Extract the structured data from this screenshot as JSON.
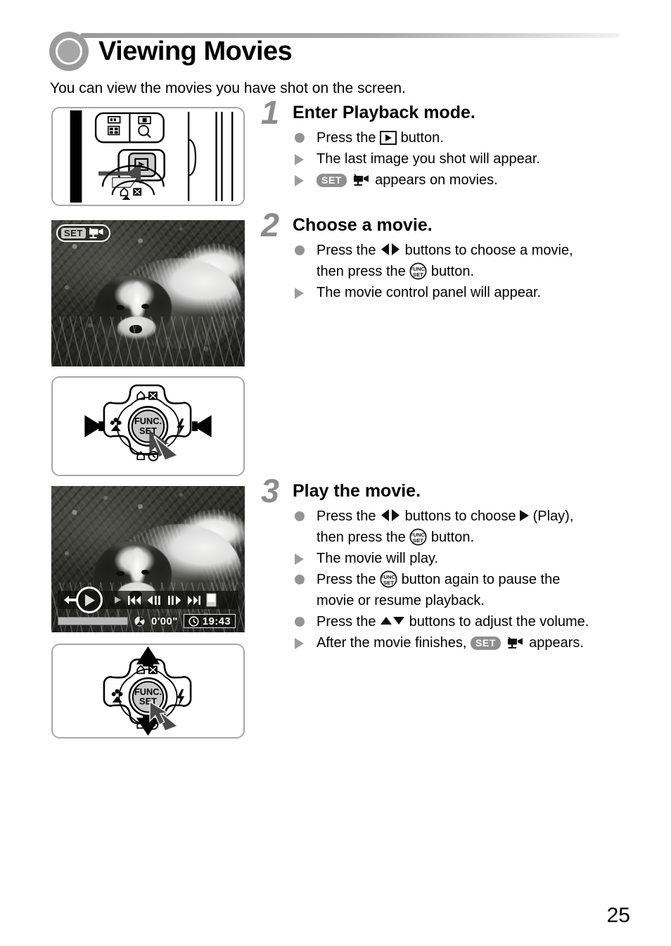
{
  "header": {
    "title": "Viewing Movies",
    "bullet_icon": "filled-circle-icon"
  },
  "intro": "You can view the movies you have shot on the screen.",
  "steps": [
    {
      "number": "1",
      "title": "Enter Playback mode.",
      "bullets": [
        {
          "marker": "dot",
          "parts": [
            "Press the ",
            "playback-button-icon",
            " button."
          ],
          "text": "Press the [playback] button."
        },
        {
          "marker": "triangle",
          "parts": [
            "The last image you shot will appear."
          ],
          "text": "The last image you shot will appear."
        },
        {
          "marker": "triangle",
          "parts": [
            "set-icon",
            "movie-icon",
            " appears on movies."
          ],
          "text": "[SET][movie] appears on movies."
        }
      ]
    },
    {
      "number": "2",
      "title": "Choose a movie.",
      "bullets": [
        {
          "marker": "dot",
          "parts": [
            "Press the ",
            "left-right-arrows-icon",
            " buttons to choose a movie,"
          ],
          "line2": [
            "then press the ",
            "func-set-icon",
            " button."
          ],
          "text": "Press the [left-right] buttons to choose a movie, then press the [FUNC/SET] button."
        },
        {
          "marker": "triangle",
          "parts": [
            "The movie control panel will appear."
          ],
          "text": "The movie control panel will appear."
        }
      ]
    },
    {
      "number": "3",
      "title": "Play the movie.",
      "bullets": [
        {
          "marker": "dot",
          "parts": [
            "Press the ",
            "left-right-arrows-icon",
            " buttons to choose ",
            "play-icon",
            " (Play),"
          ],
          "line2": [
            "then press the ",
            "func-set-icon",
            " button."
          ],
          "text": "Press the [left-right] buttons to choose [play] (Play), then press the [FUNC/SET] button."
        },
        {
          "marker": "triangle",
          "parts": [
            "The movie will play."
          ],
          "text": "The movie will play."
        },
        {
          "marker": "dot",
          "parts": [
            "Press the ",
            "func-set-icon",
            " button again to pause the"
          ],
          "line2": [
            "movie or resume playback."
          ],
          "text": "Press the [FUNC/SET] button again to pause the movie or resume playback."
        },
        {
          "marker": "dot",
          "parts": [
            "Press the ",
            "up-down-arrows-icon",
            " buttons to adjust the volume."
          ],
          "text": "Press the [up-down] buttons to adjust the volume."
        },
        {
          "marker": "triangle",
          "parts": [
            "After the movie finishes, ",
            "set-icon",
            "movie-icon",
            " appears."
          ],
          "text": "After the movie finishes, [SET][movie] appears."
        }
      ]
    }
  ],
  "figures": {
    "camera_illustration": {
      "name": "camera-back-playback-button-illustration",
      "description": "Line drawing of camera back with playback button pressed by arrow cursor"
    },
    "photo_with_set_badge": {
      "name": "movie-thumbnail-photo",
      "badge_set_label": "SET",
      "badge_movie_icon": "movie-camera-icon",
      "subject": "papillon dog in foliage"
    },
    "wheel_left_right": {
      "name": "control-wheel-left-right-illustration",
      "center_label_line1": "FUNC.",
      "center_label_line2": "SET",
      "arrows": [
        "left",
        "right"
      ],
      "wheel_icons": [
        "delete-icon",
        "exposure-icon",
        "macro-icon",
        "flash-icon",
        "display-icon",
        "timer-icon"
      ]
    },
    "movie_playback_screen": {
      "name": "movie-playback-screen",
      "controls": [
        {
          "icon": "exit-icon",
          "label": "Exit"
        },
        {
          "icon": "play-icon",
          "label": "Play",
          "selected": true
        },
        {
          "icon": "slow-motion-icon",
          "label": "Slow Motion"
        },
        {
          "icon": "skip-back-icon",
          "label": "First Frame"
        },
        {
          "icon": "frame-back-icon",
          "label": "Previous Frame"
        },
        {
          "icon": "frame-forward-icon",
          "label": "Next Frame"
        },
        {
          "icon": "skip-forward-icon",
          "label": "Last Frame"
        },
        {
          "icon": "edit-icon",
          "label": "Edit"
        }
      ],
      "elapsed_time": "0'00\"",
      "clock_icon": "clock-icon",
      "clock_time": "19:43",
      "progress_percent": 0
    },
    "wheel_up_down": {
      "name": "control-wheel-up-down-illustration",
      "center_label_line1": "FUNC.",
      "center_label_line2": "SET",
      "arrows": [
        "up",
        "down"
      ]
    }
  },
  "page_number": "25",
  "colors": {
    "step_number_gray": "#8c8c8c",
    "bullet_dot_gray": "#949494",
    "bullet_triangle_gray": "#9c9c9c",
    "panel_border_gray": "#a6a6a6",
    "header_circle_gray": "#9b9b9b",
    "set_chip_gray": "#8f8f8f"
  }
}
